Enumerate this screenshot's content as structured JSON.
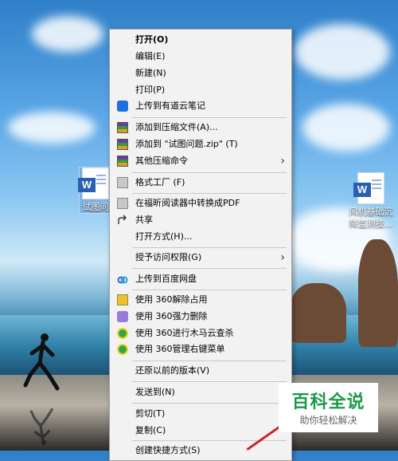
{
  "desktop": {
    "icon_left": {
      "label": "试图问",
      "icon": "word-doc-icon"
    },
    "icon_right": {
      "label_line1": "风机基础沉",
      "label_line2": "降监测技..."
    }
  },
  "context_menu": {
    "items": [
      {
        "label": "打开(O)",
        "icon": "",
        "bold": true,
        "submenu": false
      },
      {
        "label": "编辑(E)",
        "icon": "",
        "submenu": false
      },
      {
        "label": "新建(N)",
        "icon": "",
        "submenu": false
      },
      {
        "label": "打印(P)",
        "icon": "",
        "submenu": false
      },
      {
        "label": "上传到有道云笔记",
        "icon": "youdao-note-icon",
        "submenu": false
      },
      {
        "label": "添加到压缩文件(A)...",
        "icon": "archive-icon",
        "submenu": false
      },
      {
        "label": "添加到 \"试图问题.zip\" (T)",
        "icon": "archive-icon",
        "submenu": false
      },
      {
        "label": "其他压缩命令",
        "icon": "archive-icon",
        "submenu": true
      },
      {
        "label": "格式工厂 (F)",
        "icon": "format-factory-icon",
        "submenu": false
      },
      {
        "label": "在福昕阅读器中转换成PDF",
        "icon": "foxit-pdf-icon",
        "submenu": false
      },
      {
        "label": "共享",
        "icon": "share-icon",
        "submenu": false
      },
      {
        "label": "打开方式(H)...",
        "icon": "",
        "submenu": false
      },
      {
        "label": "授予访问权限(G)",
        "icon": "",
        "submenu": true
      },
      {
        "label": "上传到百度网盘",
        "icon": "baidu-netdisk-icon",
        "submenu": false
      },
      {
        "label": "使用 360解除占用",
        "icon": "360-unlock-icon",
        "submenu": false
      },
      {
        "label": "使用 360强力删除",
        "icon": "360-delete-icon",
        "submenu": false
      },
      {
        "label": "使用 360进行木马云查杀",
        "icon": "360-scan-icon",
        "submenu": false
      },
      {
        "label": "使用 360管理右键菜单",
        "icon": "360-manage-icon",
        "submenu": false
      },
      {
        "label": "还原以前的版本(V)",
        "icon": "",
        "submenu": false
      },
      {
        "label": "发送到(N)",
        "icon": "",
        "submenu": true
      },
      {
        "label": "剪切(T)",
        "icon": "",
        "submenu": false
      },
      {
        "label": "复制(C)",
        "icon": "",
        "submenu": false
      },
      {
        "label": "创建快捷方式(S)",
        "icon": "",
        "submenu": false
      }
    ],
    "arrow_glyph": "›"
  },
  "watermark": {
    "title": "百科全说",
    "subtitle": "助你轻松解决"
  }
}
